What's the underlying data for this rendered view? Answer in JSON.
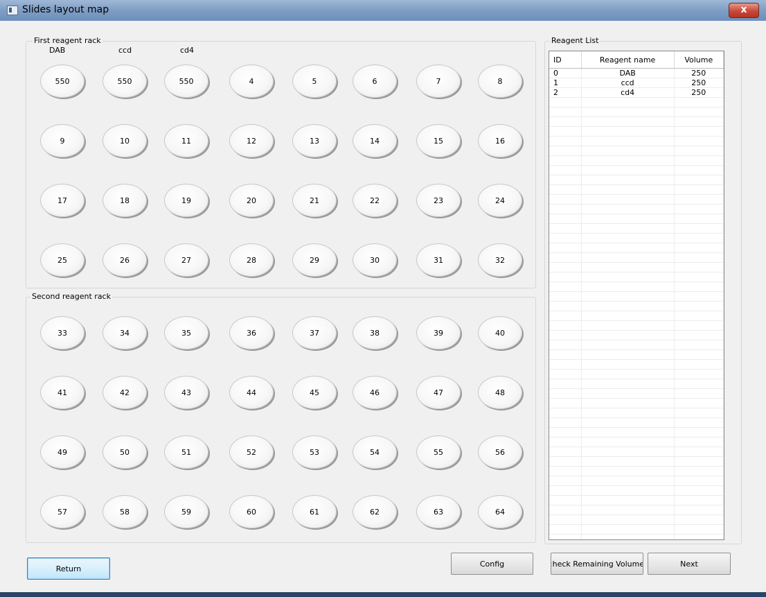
{
  "window": {
    "title": "Slides layout map",
    "close_glyph": "x"
  },
  "first_rack": {
    "title": "First reagent rack",
    "headers": [
      "DAB",
      "ccd",
      "cd4"
    ],
    "slots": [
      "550",
      "550",
      "550",
      "4",
      "5",
      "6",
      "7",
      "8",
      "9",
      "10",
      "11",
      "12",
      "13",
      "14",
      "15",
      "16",
      "17",
      "18",
      "19",
      "20",
      "21",
      "22",
      "23",
      "24",
      "25",
      "26",
      "27",
      "28",
      "29",
      "30",
      "31",
      "32"
    ]
  },
  "second_rack": {
    "title": "Second reagent rack",
    "slots": [
      "33",
      "34",
      "35",
      "36",
      "37",
      "38",
      "39",
      "40",
      "41",
      "42",
      "43",
      "44",
      "45",
      "46",
      "47",
      "48",
      "49",
      "50",
      "51",
      "52",
      "53",
      "54",
      "55",
      "56",
      "57",
      "58",
      "59",
      "60",
      "61",
      "62",
      "63",
      "64"
    ]
  },
  "reagent_list": {
    "title": "Reagent List",
    "columns": [
      "ID",
      "Reagent name",
      "Volume"
    ],
    "rows": [
      {
        "id": "0",
        "name": "DAB",
        "volume": "250"
      },
      {
        "id": "1",
        "name": "ccd",
        "volume": "250"
      },
      {
        "id": "2",
        "name": "cd4",
        "volume": "250"
      }
    ]
  },
  "buttons": {
    "return": "Return",
    "config": "Config",
    "check": ":heck Remaining Volume",
    "next": "Next"
  }
}
